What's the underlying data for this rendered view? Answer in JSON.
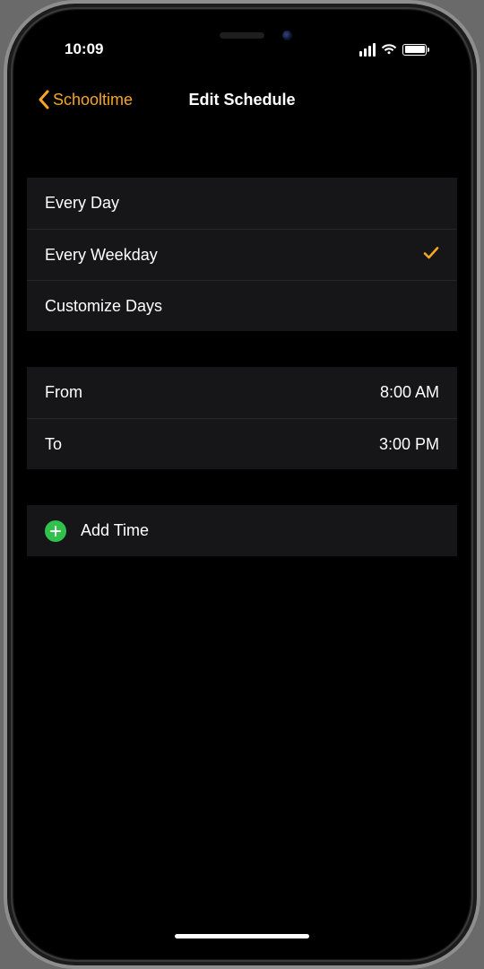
{
  "status": {
    "time": "10:09"
  },
  "nav": {
    "back_label": "Schooltime",
    "title": "Edit Schedule"
  },
  "day_options": {
    "items": [
      {
        "label": "Every Day",
        "selected": false
      },
      {
        "label": "Every Weekday",
        "selected": true
      },
      {
        "label": "Customize Days",
        "selected": false
      }
    ]
  },
  "time_range": {
    "from_label": "From",
    "from_value": "8:00 AM",
    "to_label": "To",
    "to_value": "3:00 PM"
  },
  "add_time": {
    "label": "Add Time"
  },
  "colors": {
    "accent": "#f5a623",
    "plus": "#30c24d"
  }
}
